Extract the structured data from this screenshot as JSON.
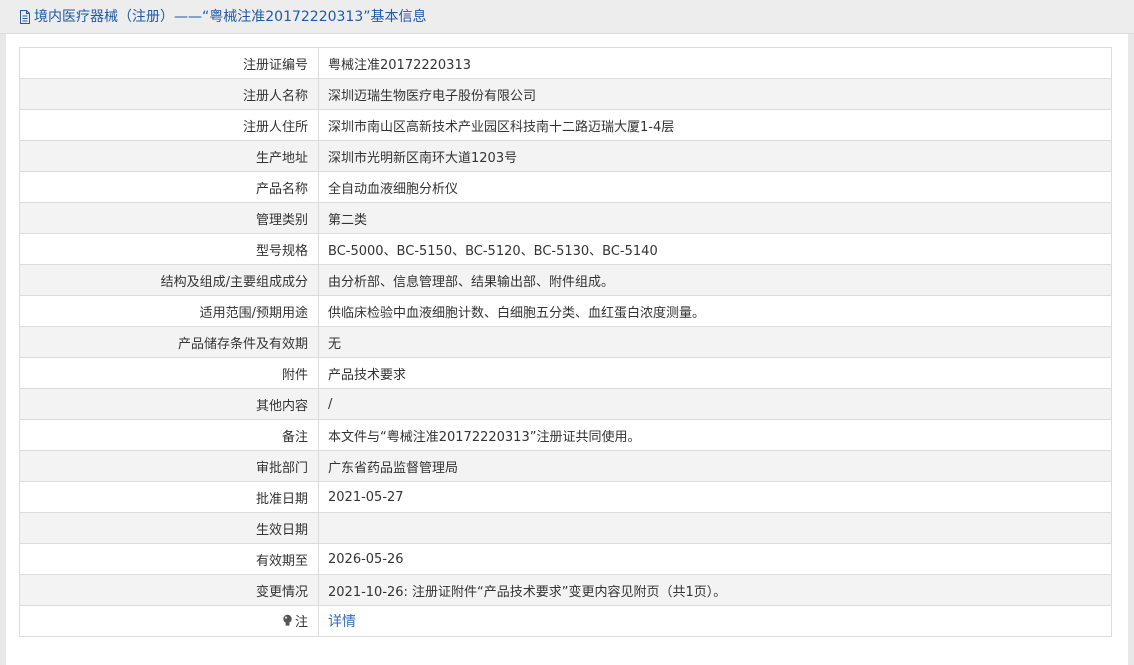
{
  "header": {
    "title": "境内医疗器械（注册）——“粤械注准20172220313”基本信息",
    "icon": "document-icon",
    "color": "#1f5aa6"
  },
  "rows": [
    {
      "name": "registration-number",
      "label": "注册证编号",
      "value": "粤械注准20172220313"
    },
    {
      "name": "registrant-name",
      "label": "注册人名称",
      "value": "深圳迈瑞生物医疗电子股份有限公司"
    },
    {
      "name": "registrant-address",
      "label": "注册人住所",
      "value": "深圳市南山区高新技术产业园区科技南十二路迈瑞大厦1-4层"
    },
    {
      "name": "production-address",
      "label": "生产地址",
      "value": "深圳市光明新区南环大道1203号"
    },
    {
      "name": "product-name",
      "label": "产品名称",
      "value": "全自动血液细胞分析仪"
    },
    {
      "name": "management-category",
      "label": "管理类别",
      "value": "第二类"
    },
    {
      "name": "model-spec",
      "label": "型号规格",
      "value": "BC-5000、BC-5150、BC-5120、BC-5130、BC-5140"
    },
    {
      "name": "structure-composition",
      "label": "结构及组成/主要组成成分",
      "value": "由分析部、信息管理部、结果输出部、附件组成。"
    },
    {
      "name": "scope-intended-use",
      "label": "适用范围/预期用途",
      "value": "供临床检验中血液细胞计数、白细胞五分类、血红蛋白浓度测量。"
    },
    {
      "name": "storage-validity",
      "label": "产品储存条件及有效期",
      "value": "无"
    },
    {
      "name": "attachment",
      "label": "附件",
      "value": "产品技术要求"
    },
    {
      "name": "other-content",
      "label": "其他内容",
      "value": "/"
    },
    {
      "name": "remarks",
      "label": "备注",
      "value": "本文件与“粤械注准20172220313”注册证共同使用。"
    },
    {
      "name": "approval-department",
      "label": "审批部门",
      "value": "广东省药品监督管理局"
    },
    {
      "name": "approval-date",
      "label": "批准日期",
      "value": "2021-05-27"
    },
    {
      "name": "effective-date",
      "label": "生效日期",
      "value": ""
    },
    {
      "name": "valid-until",
      "label": "有效期至",
      "value": "2026-05-26"
    },
    {
      "name": "change-status",
      "label": "变更情况",
      "value": "2021-10-26: 注册证附件“产品技术要求”变更内容见附页（共1页）。"
    }
  ],
  "note_row": {
    "label": "注",
    "icon": "lightbulb-icon",
    "link_text": "详情",
    "link_color": "#2a6ebd"
  }
}
